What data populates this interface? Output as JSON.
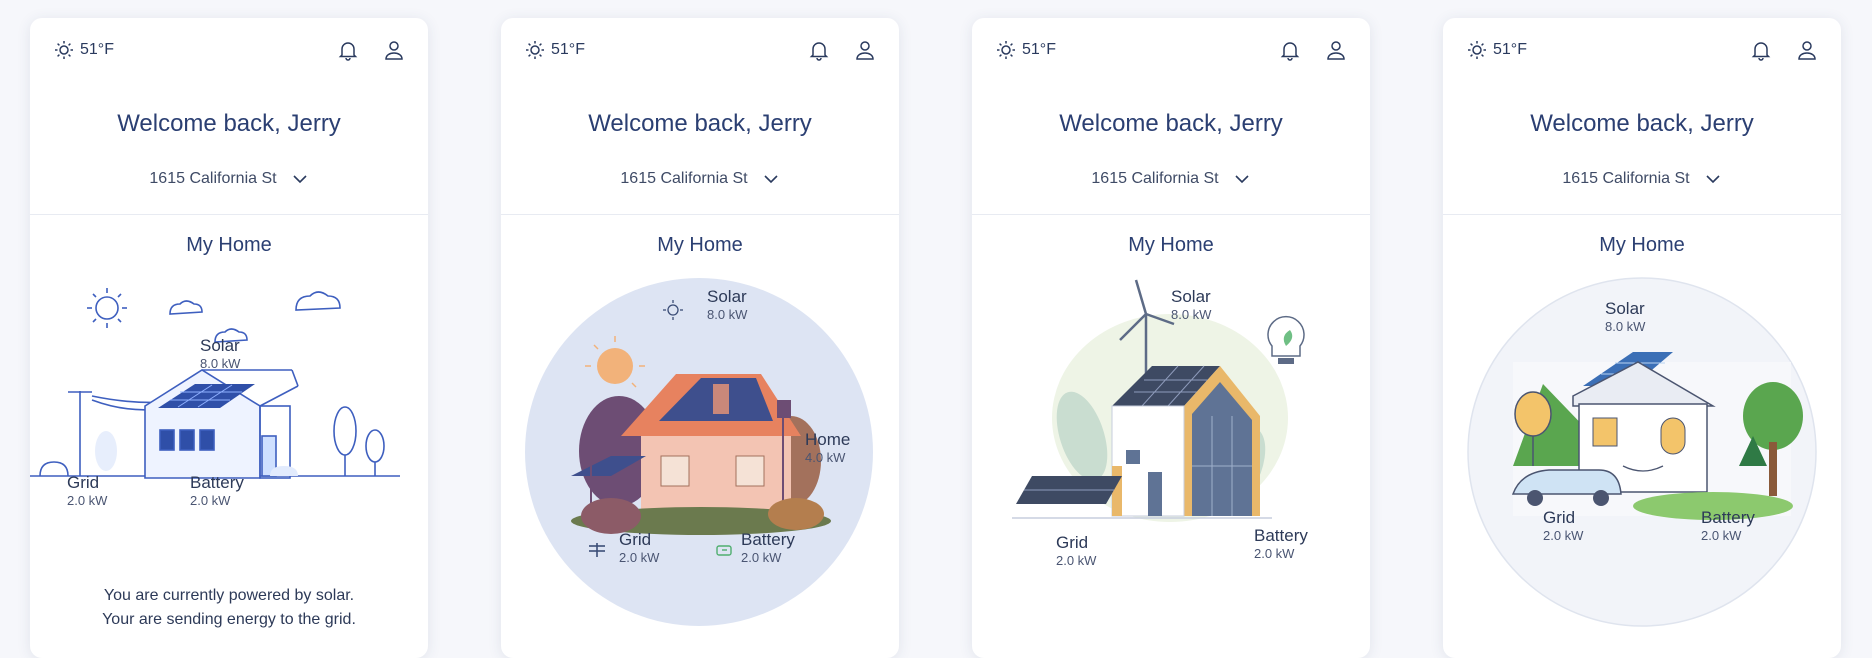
{
  "cards": [
    {
      "weather": "51°F",
      "welcome": "Welcome back, Jerry",
      "address": "1615 California St",
      "section_title": "My Home",
      "solar": {
        "label": "Solar",
        "value": "8.0 kW"
      },
      "grid": {
        "label": "Grid",
        "value": "2.0 kW"
      },
      "battery": {
        "label": "Battery",
        "value": "2.0 kW"
      },
      "message_line1": "You are currently powered by solar.",
      "message_line2": "Your are sending energy to the grid."
    },
    {
      "weather": "51°F",
      "welcome": "Welcome back, Jerry",
      "address": "1615 California St",
      "section_title": "My Home",
      "solar": {
        "label": "Solar",
        "value": "8.0 kW"
      },
      "home": {
        "label": "Home",
        "value": "4.0 kW"
      },
      "grid": {
        "label": "Grid",
        "value": "2.0 kW"
      },
      "battery": {
        "label": "Battery",
        "value": "2.0 kW"
      }
    },
    {
      "weather": "51°F",
      "welcome": "Welcome back, Jerry",
      "address": "1615 California St",
      "section_title": "My Home",
      "solar": {
        "label": "Solar",
        "value": "8.0 kW"
      },
      "grid": {
        "label": "Grid",
        "value": "2.0 kW"
      },
      "battery": {
        "label": "Battery",
        "value": "2.0 kW"
      }
    },
    {
      "weather": "51°F",
      "welcome": "Welcome back, Jerry",
      "address": "1615 California St",
      "section_title": "My Home",
      "solar": {
        "label": "Solar",
        "value": "8.0 kW"
      },
      "grid": {
        "label": "Grid",
        "value": "2.0 kW"
      },
      "battery": {
        "label": "Battery",
        "value": "2.0 kW"
      }
    }
  ],
  "icons": {
    "weather": "sun-icon",
    "notifications": "bell-icon",
    "profile": "user-icon",
    "address_dropdown": "chevron-down-icon"
  },
  "colors": {
    "accent": "#24355f",
    "line_art": "#3e5fbf",
    "panel_blue": "#2f4fa8",
    "circle_bg": "#dde4f3"
  }
}
